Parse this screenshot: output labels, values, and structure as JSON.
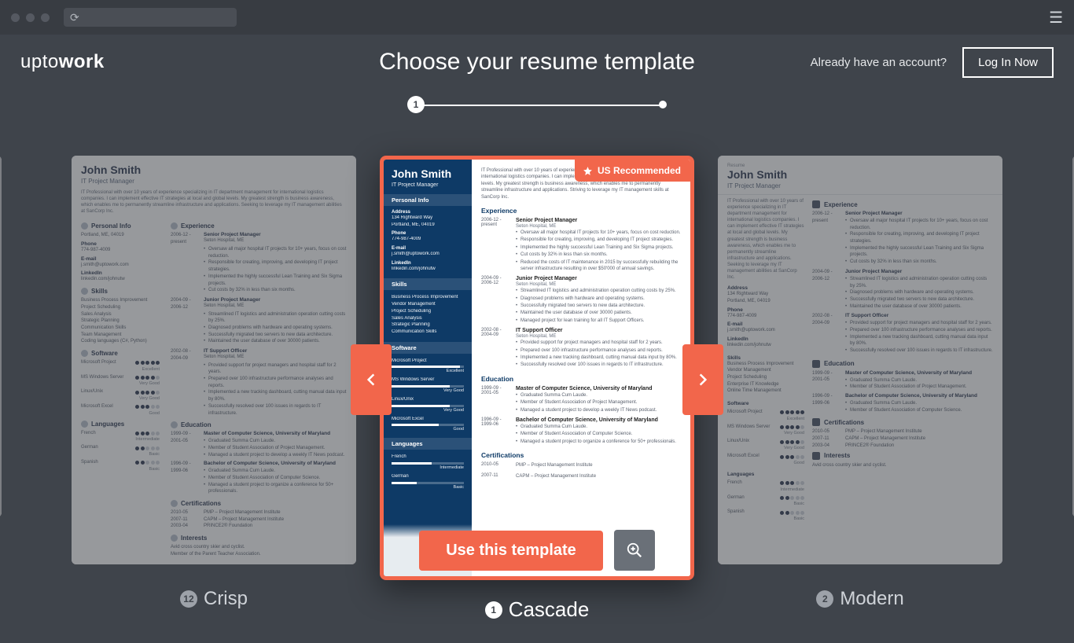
{
  "header": {
    "logo_pre": "upto",
    "logo_bold": "work",
    "title": "Choose your resume template",
    "auth_text": "Already have an account?",
    "login": "Log In Now"
  },
  "progress": {
    "step1": "1"
  },
  "badge": {
    "text": "US Recommended"
  },
  "actions": {
    "use": "Use this template"
  },
  "templates": {
    "left": {
      "num": "12",
      "name": "Crisp"
    },
    "center": {
      "num": "1",
      "name": "Cascade"
    },
    "right": {
      "num": "2",
      "name": "Modern"
    }
  },
  "resume": {
    "name": "John Smith",
    "role": "IT Project Manager",
    "summary": "IT Professional with over 10 years of experience specializing in IT department management for international logistics companies. I can implement effective IT strategies at local and global levels. My greatest strength is business awareness, which enables me to permanently streamline infrastructure and applications. Seeking to leverage my IT management abilities at SanCorp Inc.",
    "summary_short": "IT Professional with over 10 years of experience specializing in IT department management for international logistics companies. I can implement effective IT strategies at local and global levels. My greatest strength is business awareness, which enables me to permanently streamline infrastructure and applications. Striving to leverage my IT management skills at SanCorp Inc.",
    "sections_left": {
      "personal_info": "Personal Info",
      "skills": "Skills",
      "software": "Software",
      "languages": "Languages",
      "experience": "Experience",
      "education": "Education",
      "certifications": "Certifications",
      "interests": "Interests"
    },
    "personal": {
      "addr1": "134 Rightward Way",
      "addr2": "Portland, ME, 04019",
      "phone_label": "Phone",
      "phone": "774-987-4009",
      "email_label": "E-mail",
      "email": "j.smith@uptowork.com",
      "linkedin_label": "LinkedIn",
      "linkedin": "linkedin.com/johnutw"
    },
    "skills": [
      "Business Process Improvement",
      "Vendor Management",
      "Project Scheduling",
      "Sales Analysis",
      "Strategic Planning",
      "Communication Skills",
      "Team Management",
      "Coding languages (C#, Python)"
    ],
    "software": [
      {
        "name": "Microsoft Project",
        "level": "Excellent",
        "pct": 95
      },
      {
        "name": "MS Windows Server",
        "level": "Very Good",
        "pct": 80
      },
      {
        "name": "Linux/Unix",
        "level": "Very Good",
        "pct": 80
      },
      {
        "name": "Microsoft Excel",
        "level": "Good",
        "pct": 65
      }
    ],
    "languages": [
      {
        "name": "French",
        "level": "Intermediate",
        "pct": 55
      },
      {
        "name": "German",
        "level": "Basic",
        "pct": 35
      },
      {
        "name": "Spanish",
        "level": "Basic",
        "pct": 30
      }
    ],
    "experience": [
      {
        "dates": "2006-12 - present",
        "role": "Senior Project Manager",
        "org": "Seton Hospital, ME",
        "bullets": [
          "Oversaw all major hospital IT projects for 10+ years, focus on cost reduction.",
          "Responsible for creating, improving, and developing IT project strategies.",
          "Implemented the highly successful Lean Training and Six Sigma projects.",
          "Cut costs by 32% in less than six months.",
          "Reduced the costs of IT maintenance in 2015 by successfully rebuilding the server infrastructure resulting in over $50'000 of annual savings."
        ]
      },
      {
        "dates": "2004-09 - 2006-12",
        "role": "Junior Project Manager",
        "org": "Seton Hospital, ME",
        "bullets": [
          "Streamlined IT logistics and administration operation cutting costs by 25%.",
          "Diagnosed problems with hardware and operating systems.",
          "Successfully migrated two servers to new data architecture.",
          "Maintained the user database of over 30000 patients.",
          "Managed project for lean training for all IT Support Officers."
        ]
      },
      {
        "dates": "2002-08 - 2004-09",
        "role": "IT Support Officer",
        "org": "Seton Hospital, ME",
        "bullets": [
          "Provided support for project managers and hospital staff for 2 years.",
          "Prepared over 100 infrastructure performance analyses and reports.",
          "Implemented a new tracking dashboard, cutting manual data input by 80%.",
          "Successfully resolved over 100 issues in regards to IT infrastructure."
        ]
      }
    ],
    "education": [
      {
        "dates": "1999-09 - 2001-05",
        "title": "Master of Computer Science, University of Maryland",
        "bullets": [
          "Graduated Summa Cum Laude.",
          "Member of Student Association of Project Management.",
          "Managed a student project to develop a weekly IT News podcast."
        ]
      },
      {
        "dates": "1996-09 - 1999-06",
        "title": "Bachelor of Computer Science, University of Maryland",
        "bullets": [
          "Graduated Summa Cum Laude.",
          "Member of Student Association of Computer Science.",
          "Managed a student project to organize a conference for 50+ professionals."
        ]
      }
    ],
    "certifications": [
      {
        "dates": "2010-05",
        "title": "PMP – Project Management Institute"
      },
      {
        "dates": "2007-11",
        "title": "CAPM – Project Management Institute"
      },
      {
        "dates": "2003-04",
        "title": "PRINCE2® Foundation"
      }
    ],
    "interests": [
      "Avid cross country skier and cyclist.",
      "Member of the Parent Teacher Association."
    ]
  }
}
